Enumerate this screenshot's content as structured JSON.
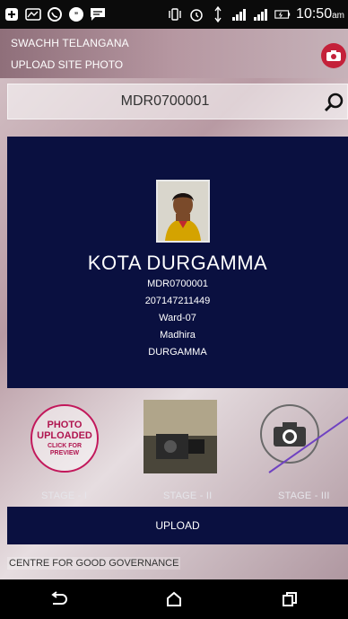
{
  "status_bar": {
    "time": "10:50",
    "ampm": "am",
    "icons": [
      "add-icon",
      "message-icon",
      "whatsapp-icon",
      "chat-icon",
      "sms-icon",
      "vibrate-icon",
      "alarm-icon",
      "data-icon",
      "signal-icon",
      "signal-icon",
      "battery-icon"
    ]
  },
  "header": {
    "title": "SWACHH TELANGANA",
    "subtitle": "UPLOAD SITE PHOTO"
  },
  "search": {
    "value": "MDR0700001"
  },
  "profile": {
    "name": "KOTA DURGAMMA",
    "details": [
      "MDR0700001",
      "207147211449",
      "Ward-07",
      "Madhira",
      "DURGAMMA"
    ]
  },
  "stages": {
    "stage1": {
      "line1": "PHOTO",
      "line2": "UPLOADED",
      "line3": "CLICK FOR",
      "line4": "PREVIEW",
      "label": "STAGE - I"
    },
    "stage2": {
      "label": "STAGE - II"
    },
    "stage3": {
      "label": "STAGE - III"
    }
  },
  "upload_label": "UPLOAD",
  "footer": "CENTRE FOR GOOD GOVERNANCE",
  "colors": {
    "accent": "#c4213a",
    "card": "#0a1040",
    "stage1": "#c2185b"
  }
}
